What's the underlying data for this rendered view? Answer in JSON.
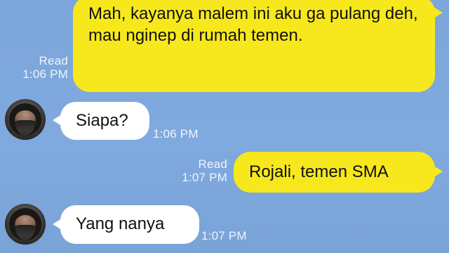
{
  "messages": [
    {
      "direction": "outgoing",
      "text": "Mah, kayanya malem ini aku ga pulang deh, mau nginep di rumah temen.",
      "status": "Read",
      "time": "1:06 PM"
    },
    {
      "direction": "incoming",
      "text": "Siapa?",
      "time": "1:06 PM"
    },
    {
      "direction": "outgoing",
      "text": "Rojali, temen SMA",
      "status": "Read",
      "time": "1:07 PM"
    },
    {
      "direction": "incoming",
      "text": "Yang nanya",
      "time": "1:07 PM"
    }
  ],
  "colors": {
    "background": "#7fa8dc",
    "outgoing_bubble": "#f7e81d",
    "incoming_bubble": "#ffffff",
    "meta_text": "#ffffff"
  },
  "icons": {
    "avatar": "avatar-icon"
  }
}
